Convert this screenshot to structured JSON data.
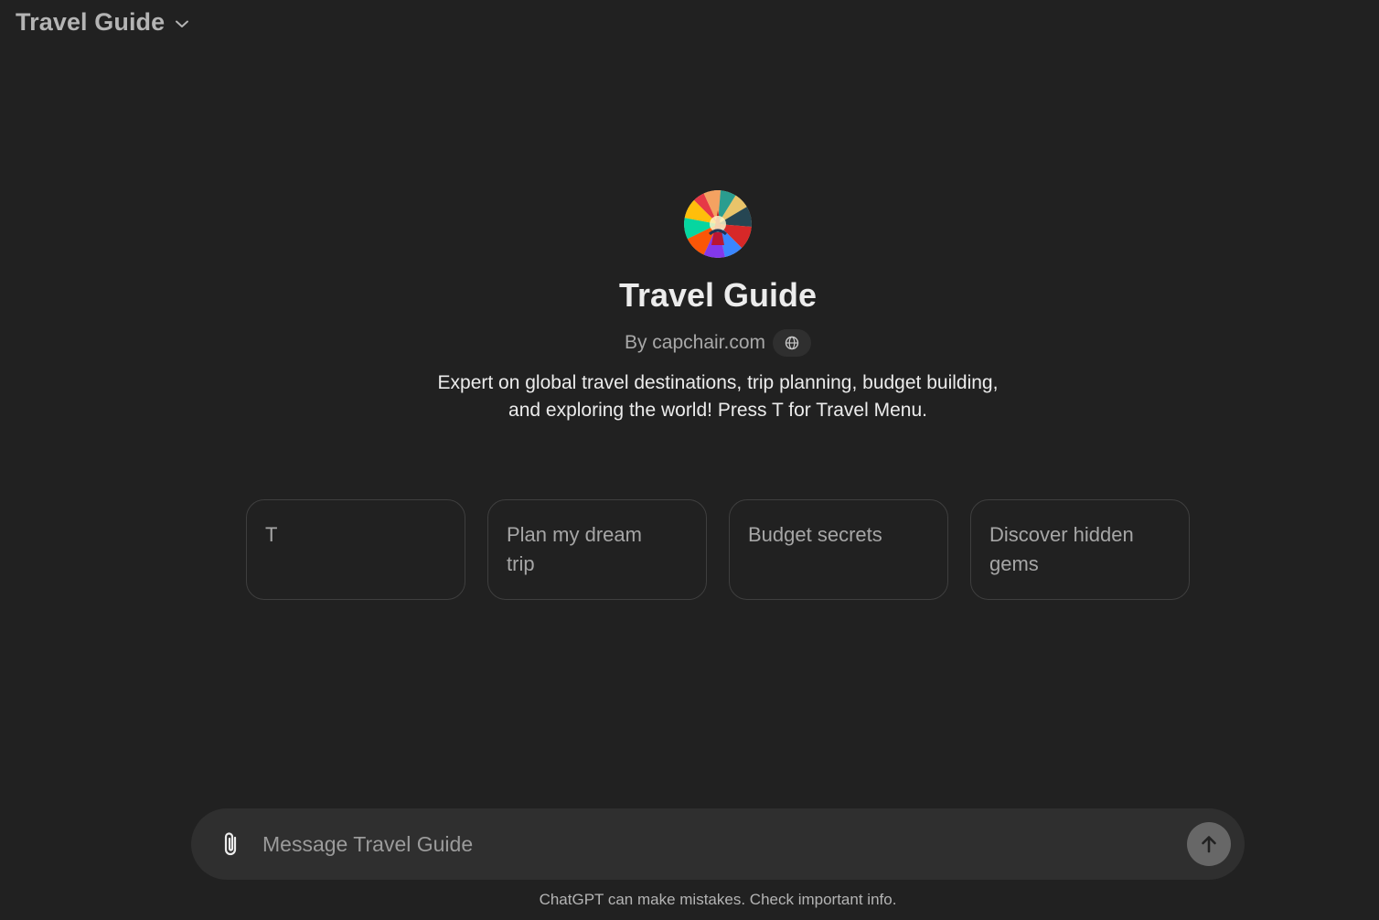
{
  "header": {
    "model_name": "Travel Guide",
    "dropdown_icon": "chevron-down-icon"
  },
  "gpt": {
    "title": "Travel Guide",
    "byline": "By capchair.com",
    "globe_icon": "globe-icon",
    "description_line1": "Expert on global travel destinations, trip planning, budget building,",
    "description_line2": "and exploring the world! Press T for Travel Menu."
  },
  "starters": [
    {
      "label": "T"
    },
    {
      "label": "Plan my dream trip"
    },
    {
      "label": "Budget secrets"
    },
    {
      "label": "Discover hidden gems"
    }
  ],
  "composer": {
    "placeholder": "Message Travel Guide",
    "value": "",
    "attach_icon": "paperclip-icon",
    "send_icon": "arrow-up-icon"
  },
  "footer": {
    "note": "ChatGPT can make mistakes. Check important info."
  },
  "colors": {
    "background": "#212121",
    "composer_bg": "#2f2f2f",
    "send_button": "#676767",
    "card_border": "#3f3f3f"
  }
}
